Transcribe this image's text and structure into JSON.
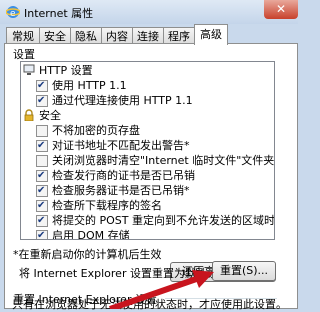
{
  "window": {
    "title": "Internet 属性",
    "close_symbol": "✕"
  },
  "tabs": [
    "常规",
    "安全",
    "隐私",
    "内容",
    "连接",
    "程序",
    "高级"
  ],
  "settings_group": {
    "label": "设置",
    "items": [
      {
        "type": "category",
        "icon": "monitor-icon",
        "text": "HTTP 设置"
      },
      {
        "type": "checkbox",
        "checked": true,
        "text": "使用 HTTP 1.1"
      },
      {
        "type": "checkbox",
        "checked": true,
        "text": "通过代理连接使用 HTTP 1.1"
      },
      {
        "type": "category",
        "icon": "lock-icon",
        "text": "安全"
      },
      {
        "type": "checkbox",
        "checked": false,
        "text": "不将加密的页存盘"
      },
      {
        "type": "checkbox",
        "checked": true,
        "text": "对证书地址不匹配发出警告*"
      },
      {
        "type": "checkbox",
        "checked": false,
        "text": "关闭浏览器时清空\"Internet 临时文件\"文件夹"
      },
      {
        "type": "checkbox",
        "checked": true,
        "text": "检查发行商的证书是否已吊销"
      },
      {
        "type": "checkbox",
        "checked": true,
        "text": "检查服务器证书是否已吊销*"
      },
      {
        "type": "checkbox",
        "checked": true,
        "text": "检查所下载程序的签名"
      },
      {
        "type": "checkbox",
        "checked": true,
        "text": "将提交的 POST 重定向到不允许发送的区域时发出警告"
      },
      {
        "type": "checkbox",
        "checked": true,
        "text": "启用 DOM 存储"
      }
    ],
    "note": "*在重新启动你的计算机后生效",
    "restore_button": "还原高级设置(R)"
  },
  "reset_group": {
    "label": "重置 Internet Explorer 设置",
    "description": "将 Internet Explorer 设置重置为默认设置。",
    "reset_button": "重置(S)...",
    "footer": "只有在浏览器处于无法使用的状态时，才应使用此设置。"
  },
  "colors": {
    "arrow": "#c8141e"
  }
}
